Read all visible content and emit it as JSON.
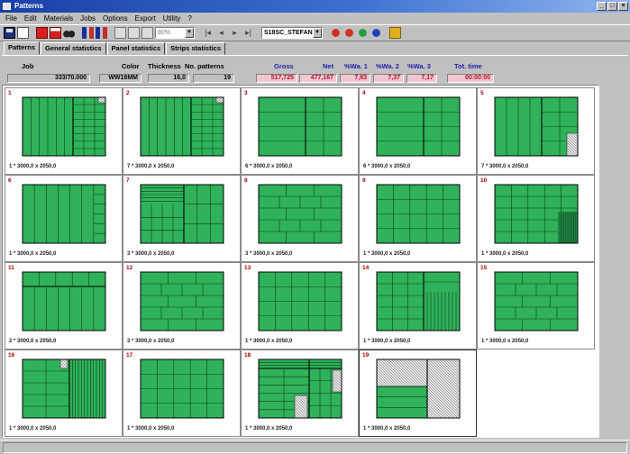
{
  "window": {
    "title": "Patterns"
  },
  "menu": [
    "File",
    "Edit",
    "Materials",
    "Jobs",
    "Options",
    "Export",
    "Utility",
    "?"
  ],
  "toolbar": {
    "zoom_value": "80%",
    "material_value": "S18SC_STEFAN"
  },
  "tabs": [
    {
      "label": "Patterns",
      "active": true
    },
    {
      "label": "General statistics",
      "active": false
    },
    {
      "label": "Panel statistics",
      "active": false
    },
    {
      "label": "Strips statistics",
      "active": false
    }
  ],
  "header": {
    "job_label": "Job",
    "job_value": "333/70.000",
    "color_label": "Color",
    "color_value": "WW18MM",
    "thickness_label": "Thickness",
    "thickness_value": "16,0",
    "patterns_label": "No. patterns",
    "patterns_value": "19",
    "gross_label": "Gross",
    "gross_value": "517,725",
    "net_label": "Net",
    "net_value": "477,167",
    "sw1_label": "%Wa. 1",
    "sw1_value": "7,83",
    "sw2_label": "%Wa. 2",
    "sw2_value": "7,37",
    "sw3_label": "%Wa. 3",
    "sw3_value": "7,17",
    "time_label": "Tot. time",
    "time_value": "00:00:00"
  },
  "colors": {
    "panel": "#2fb25a",
    "line": "#0d3d1a",
    "waste": "#bbbbbb"
  },
  "patterns": [
    {
      "n": "1",
      "cap": "1 * 3000,0 x 2050,0",
      "layout": "A"
    },
    {
      "n": "2",
      "cap": "7 * 3000,0 x 2050,0",
      "layout": "A"
    },
    {
      "n": "3",
      "cap": "6 * 3000,0 x 2050,0",
      "layout": "B"
    },
    {
      "n": "4",
      "cap": "6 * 3000,0 x 2050,0",
      "layout": "B"
    },
    {
      "n": "5",
      "cap": "7 * 3000,0 x 2050,0",
      "layout": "C"
    },
    {
      "n": "6",
      "cap": "1 * 3000,0 x 2050,0",
      "layout": "D"
    },
    {
      "n": "7",
      "cap": "3 * 3000,0 x 2050,0",
      "layout": "E"
    },
    {
      "n": "8",
      "cap": "3 * 3000,0 x 2050,0",
      "layout": "F"
    },
    {
      "n": "9",
      "cap": "1 * 3000,0 x 2050,0",
      "layout": "G"
    },
    {
      "n": "10",
      "cap": "1 * 3000,0 x 2050,0",
      "layout": "H"
    },
    {
      "n": "11",
      "cap": "2 * 3000,0 x 2050,0",
      "layout": "I"
    },
    {
      "n": "12",
      "cap": "3 * 3000,0 x 2050,0",
      "layout": "F"
    },
    {
      "n": "13",
      "cap": "1 * 3000,0 x 2050,0",
      "layout": "G"
    },
    {
      "n": "14",
      "cap": "1 * 3000,0 x 2050,0",
      "layout": "J"
    },
    {
      "n": "15",
      "cap": "1 * 3000,0 x 2050,0",
      "layout": "F"
    },
    {
      "n": "16",
      "cap": "1 * 3000,0 x 2050,0",
      "layout": "K"
    },
    {
      "n": "17",
      "cap": "1 * 3000,0 x 2050,0",
      "layout": "G"
    },
    {
      "n": "18",
      "cap": "1 * 3000,0 x 2050,0",
      "layout": "L"
    },
    {
      "n": "19",
      "cap": "1 * 3000,0 x 2050,0",
      "layout": "M"
    }
  ]
}
